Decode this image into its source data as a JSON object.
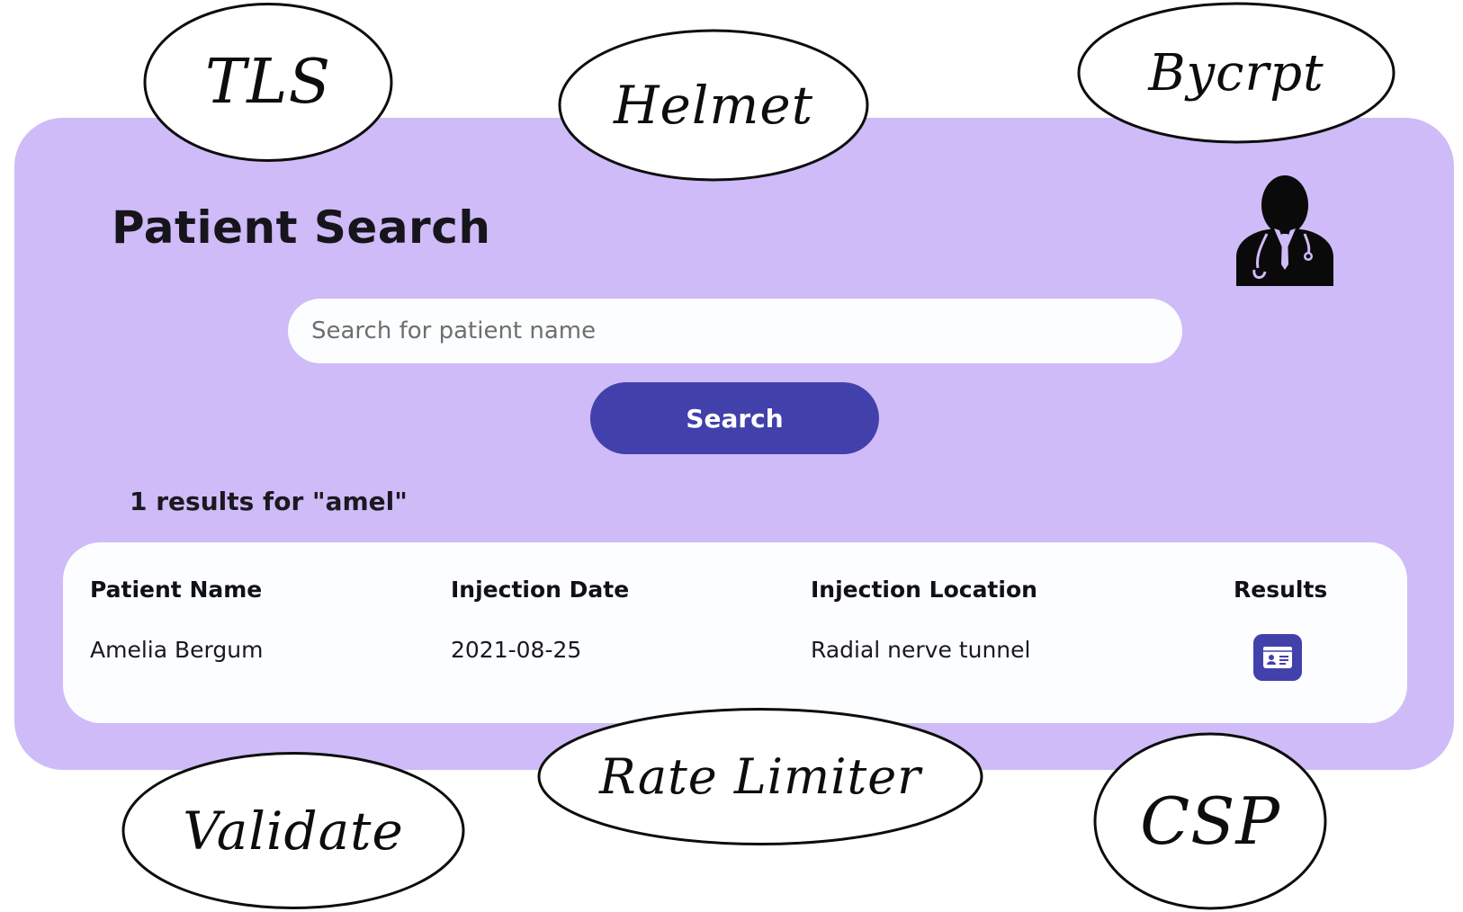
{
  "page": {
    "title": "Patient Search",
    "search_placeholder": "Search for patient name",
    "search_button": "Search",
    "results_summary": "1 results for \"amel\""
  },
  "table": {
    "headers": [
      "Patient Name",
      "Injection Date",
      "Injection Location",
      "Results"
    ],
    "rows": [
      {
        "name": "Amelia Bergum",
        "date": "2021-08-25",
        "location": "Radial nerve tunnel",
        "result_icon": "id-card-icon"
      }
    ]
  },
  "icons": {
    "doctor": "doctor-avatar-icon",
    "result": "id-card-icon"
  },
  "annotations": [
    "TLS",
    "Helmet",
    "Bycrpt",
    "Validate",
    "Rate Limiter",
    "CSP"
  ],
  "colors": {
    "card_bg": "#cfbbf7",
    "accent": "#4240ab",
    "surface": "#fbfdfe"
  }
}
